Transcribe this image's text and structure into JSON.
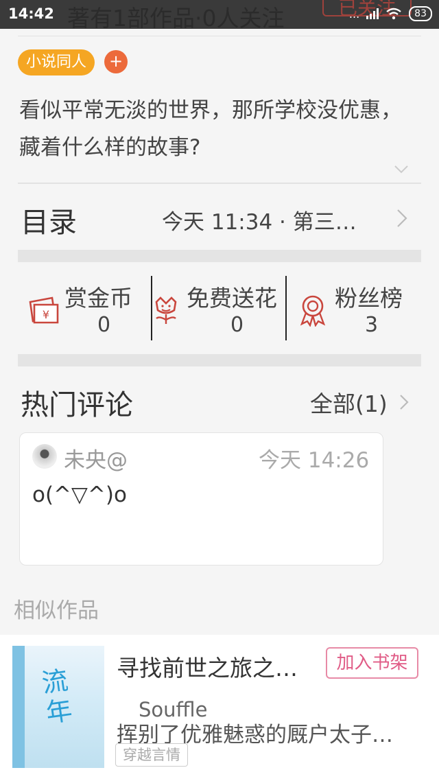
{
  "status_bar": {
    "time": "14:42",
    "battery": "83",
    "signal_dots": "...",
    "behind_title": "著有1部作品·0人关注",
    "behind_button": "已关注"
  },
  "work": {
    "tag": "小说同人",
    "tag_add": "+",
    "description": "看似平常无淡的世界，那所学校没优惠，藏着什么样的故事?"
  },
  "toc": {
    "title": "目录",
    "latest": "今天 11:34 · 第三…"
  },
  "stats": [
    {
      "label": "赏金币",
      "value": "0",
      "icon": "reward-envelope-icon"
    },
    {
      "label": "免费送花",
      "value": "0",
      "icon": "flower-icon"
    },
    {
      "label": "粉丝榜",
      "value": "3",
      "icon": "medal-icon"
    }
  ],
  "hot_comments": {
    "title": "热门评论",
    "all_label": "全部(1)",
    "items": [
      {
        "user": "未央@",
        "time": "今天 14:26",
        "text": "o(^▽^)o"
      }
    ]
  },
  "similar": {
    "title": "相似作品",
    "books": [
      {
        "title": "寻找前世之旅之…",
        "author": "Souffle",
        "summary": "挥别了优雅魅惑的厩户太子…",
        "tag": "穿越言情",
        "button": "加入书架",
        "cover_text": "流年"
      }
    ]
  },
  "colors": {
    "tag": "#f5a623",
    "tag_add": "#ec6a3b",
    "icon_red": "#c9463d",
    "shelf_btn": "#e05b86"
  }
}
